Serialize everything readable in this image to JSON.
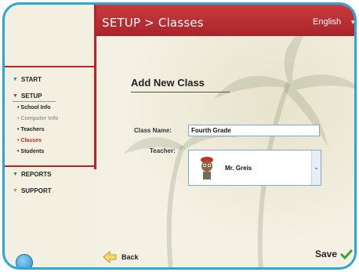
{
  "header": {
    "title": "SETUP > Classes",
    "language": "English"
  },
  "sidebar": {
    "items": [
      {
        "label": "START",
        "color": "#2a7fc8"
      },
      {
        "label": "SETUP",
        "color": "#c02a2e"
      },
      {
        "label": "REPORTS",
        "color": "#2e8b35"
      },
      {
        "label": "SUPPORT",
        "color": "#e08a1b"
      }
    ],
    "setup_sub": [
      {
        "label": "• School Info"
      },
      {
        "label": "• Computer Info"
      },
      {
        "label": "• Teachers"
      },
      {
        "label": "• Classes"
      },
      {
        "label": "• Students"
      }
    ]
  },
  "form": {
    "title": "Add New Class",
    "class_name_label": "Class Name:",
    "class_name_value": "Fourth Grade",
    "teacher_label": "Teacher:",
    "teacher_value": "Mr. Greis"
  },
  "footer": {
    "back_label": "Back",
    "save_label": "Save"
  },
  "colors": {
    "accent_red": "#b3262c",
    "frame_blue": "#2aa6d8"
  }
}
